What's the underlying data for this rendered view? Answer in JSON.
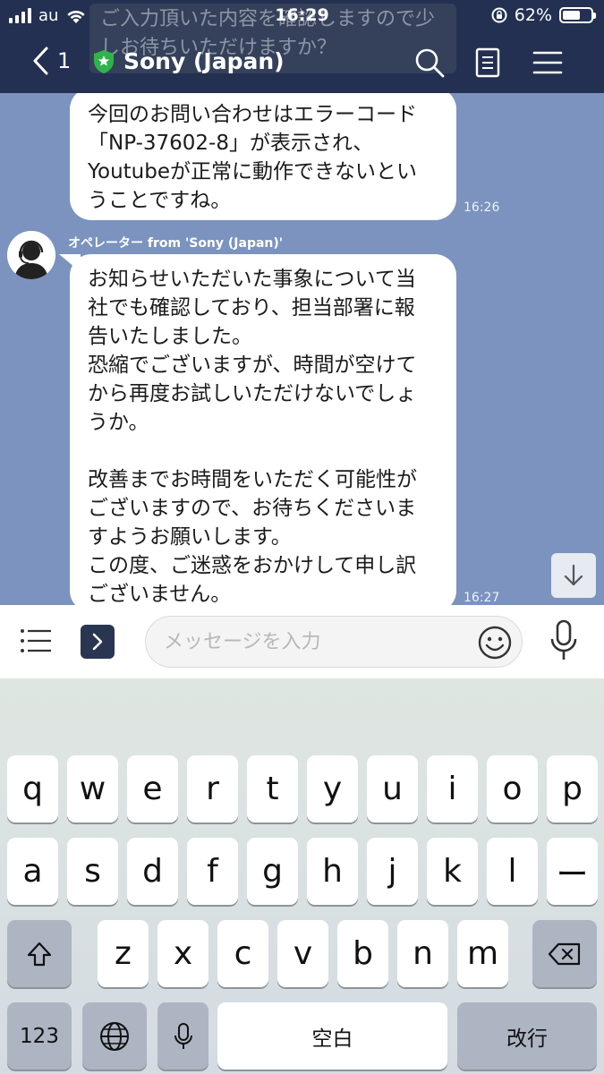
{
  "status_bar": {
    "carrier": "au",
    "time": "16:29",
    "battery": "62%",
    "battery_level": 0.62
  },
  "header": {
    "ghost_notice": "ご入力頂いた内容を確認しますので少しお待ちいただけますか？",
    "back_count": "1",
    "title": "Sony (Japan)"
  },
  "messages": [
    {
      "text": "今回のお問い合わせはエラーコード\n「NP-37602-8」が表示され、\nYoutubeが正常に動作できないとい\nうことですね。",
      "time": "16:26"
    },
    {
      "sender": "オペレーター from 'Sony (Japan)'",
      "text": "お知らせいただいた事象について当\n社でも確認しており、担当部署に報\n告いたしました。\n恐縮でございますが、時間が空けて\nから再度お試しいただけないでしょ\nうか。\n\n改善までお時間をいただく可能性が\nございますので、お待ちくださいま\nすようお願いします。\nこの度、ご迷惑をおかけして申し訳\nございません。",
      "time": "16:27"
    }
  ],
  "input": {
    "placeholder": "メッセージを入力"
  },
  "keyboard": {
    "row1": [
      "q",
      "w",
      "e",
      "r",
      "t",
      "y",
      "u",
      "i",
      "o",
      "p"
    ],
    "row2": [
      "a",
      "s",
      "d",
      "f",
      "g",
      "h",
      "j",
      "k",
      "l",
      "ー"
    ],
    "row3": [
      "z",
      "x",
      "c",
      "v",
      "b",
      "n",
      "m"
    ],
    "numbers": "123",
    "space": "空白",
    "return": "改行"
  }
}
